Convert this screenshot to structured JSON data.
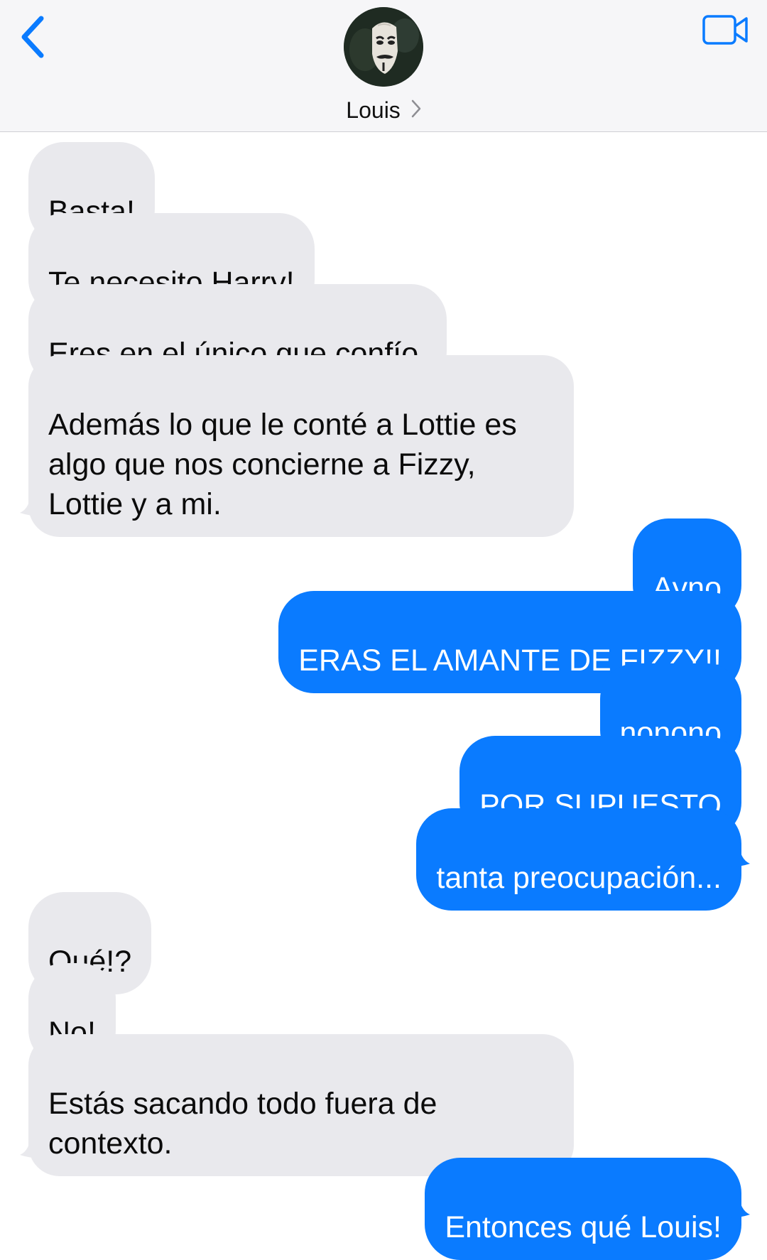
{
  "header": {
    "contact_name": "Louis",
    "back_icon": "chevron-left-icon",
    "video_icon": "video-camera-icon",
    "accent_color": "#0a7bff"
  },
  "messages": [
    {
      "direction": "received",
      "text": "Basta!"
    },
    {
      "direction": "received",
      "text": "Te necesito Harry!"
    },
    {
      "direction": "received",
      "text": "Eres en el único que confío."
    },
    {
      "direction": "received",
      "text": "Además lo que le conté a Lottie es\nalgo que nos concierne a Fizzy,\nLottie y a mi."
    },
    {
      "direction": "sent",
      "text": "Ayno"
    },
    {
      "direction": "sent",
      "text": "ERAS EL AMANTE DE FIZZY!!"
    },
    {
      "direction": "sent",
      "text": "nonono"
    },
    {
      "direction": "sent",
      "text": "POR SUPUESTO"
    },
    {
      "direction": "sent",
      "text": "tanta preocupación..."
    },
    {
      "direction": "received",
      "text": "Qué!?"
    },
    {
      "direction": "received",
      "text": "No!"
    },
    {
      "direction": "received",
      "text": "Estás sacando todo fuera de\ncontexto."
    },
    {
      "direction": "sent",
      "text": "Entonces qué Louis!"
    }
  ]
}
